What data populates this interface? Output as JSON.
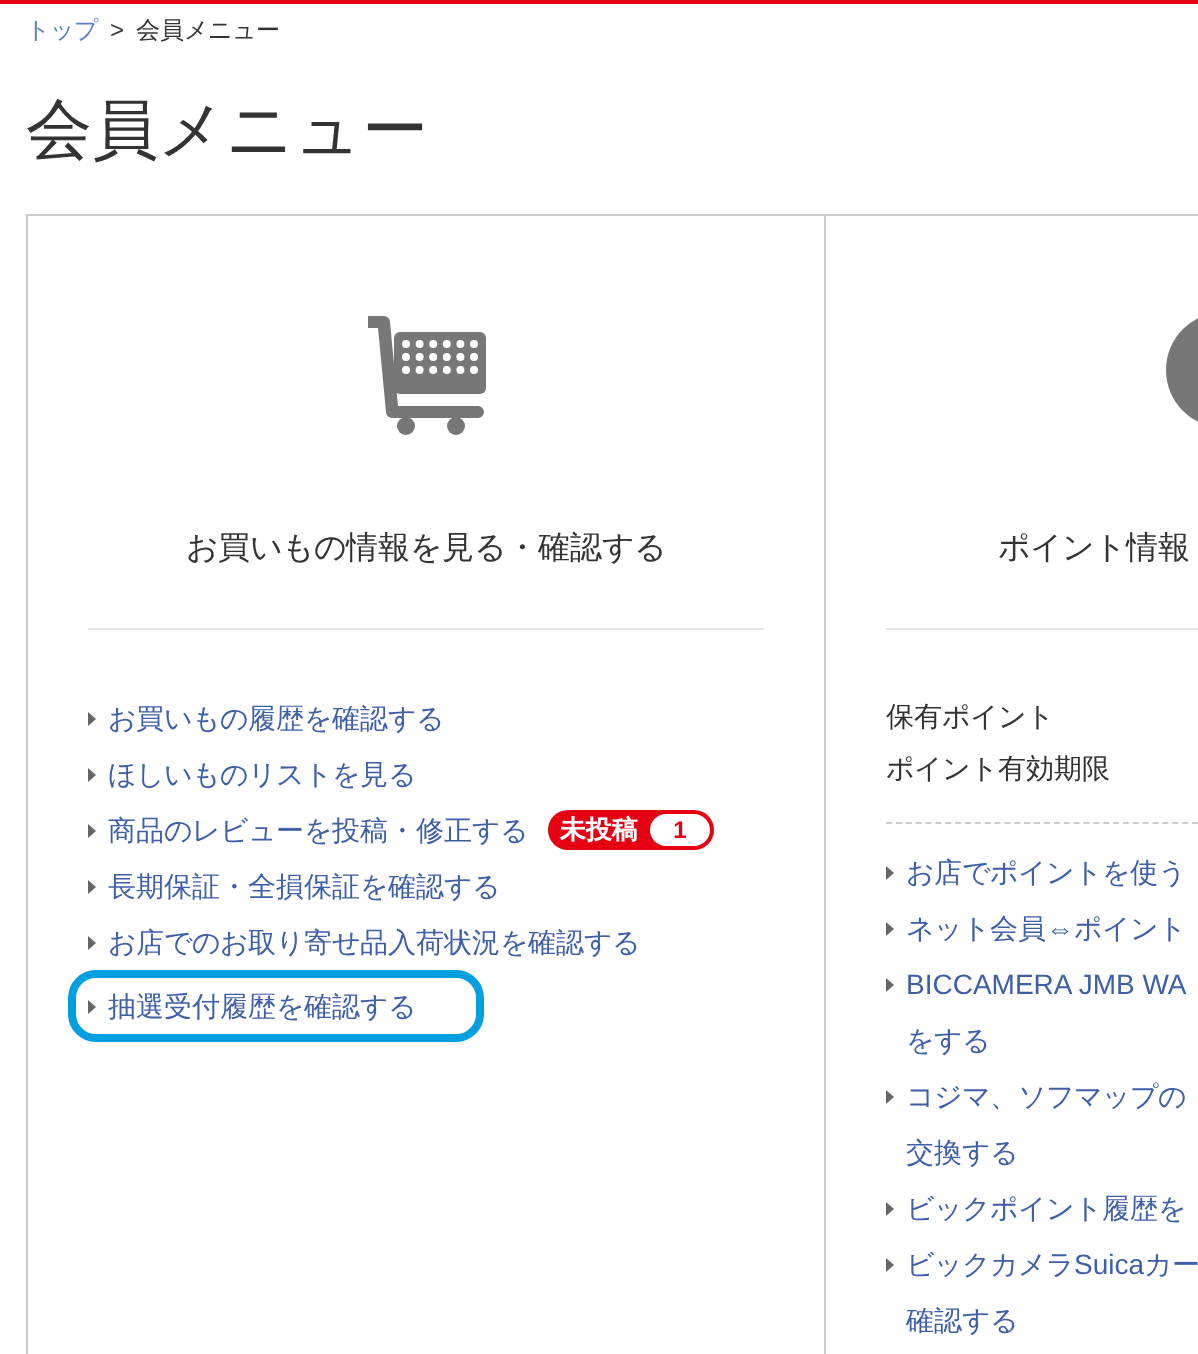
{
  "breadcrumb": [
    {
      "label": "トップ",
      "kind": "link"
    },
    {
      "label": "会員メニュー",
      "kind": "current"
    }
  ],
  "breadcrumb_separator": ">",
  "title": "会員メニュー",
  "cards": [
    {
      "heading": "お買いもの情報を見る・確認する",
      "kind": "cart",
      "links": [
        {
          "lines": [
            "お買いもの履歴を確認する"
          ],
          "highlighted": false
        },
        {
          "lines": [
            "ほしいものリストを見る"
          ],
          "highlighted": false
        },
        {
          "lines": [
            "商品のレビューを投稿・修正する"
          ],
          "highlighted": false,
          "badge": {
            "label": "未投稿",
            "count": "1"
          }
        },
        {
          "lines": [
            "長期保証・全損保証を確認する"
          ],
          "highlighted": false
        },
        {
          "lines": [
            "お店でのお取り寄せ品入荷状況を確認する"
          ],
          "highlighted": false
        },
        {
          "lines": [
            "抽選受付履歴を確認する"
          ],
          "highlighted": true
        }
      ]
    },
    {
      "heading": "ポイント情報",
      "kind": "circle",
      "info": [
        "保有ポイント",
        "ポイント有効期限"
      ],
      "links": [
        {
          "lines": [
            "お店でポイントを使う"
          ],
          "highlighted": false
        },
        {
          "lines": [
            "ネット会員⇔ポイント"
          ],
          "highlighted": false
        },
        {
          "lines": [
            "BICCAMERA JMB WA",
            "をする"
          ],
          "highlighted": false
        },
        {
          "lines": [
            "コジマ、ソフマップの",
            "交換する"
          ],
          "highlighted": false
        },
        {
          "lines": [
            "ビックポイント履歴を"
          ],
          "highlighted": false
        },
        {
          "lines": [
            "ビックカメラSuicaカー",
            "確認する"
          ],
          "highlighted": false
        }
      ]
    }
  ]
}
